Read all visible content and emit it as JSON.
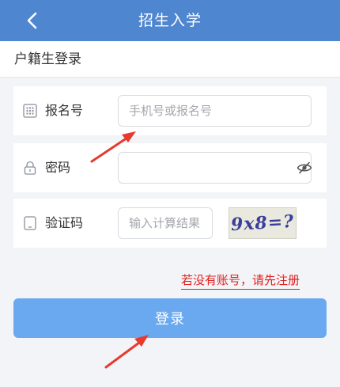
{
  "header": {
    "title": "招生入学"
  },
  "section": {
    "title": "户籍生登录"
  },
  "form": {
    "registration_label": "报名号",
    "registration_placeholder": "手机号或报名号",
    "password_label": "密码",
    "password_value": "",
    "captcha_label": "验证码",
    "captcha_placeholder": "输入计算结果",
    "captcha_image_text": "9x8=?"
  },
  "register_link": "若没有账号，请先注册",
  "login_button": "登录",
  "colors": {
    "header_bg": "#4f86d0",
    "login_button_bg": "#6aa9ef",
    "register_link": "#e02020",
    "annotation_arrow": "#e63b2e"
  }
}
